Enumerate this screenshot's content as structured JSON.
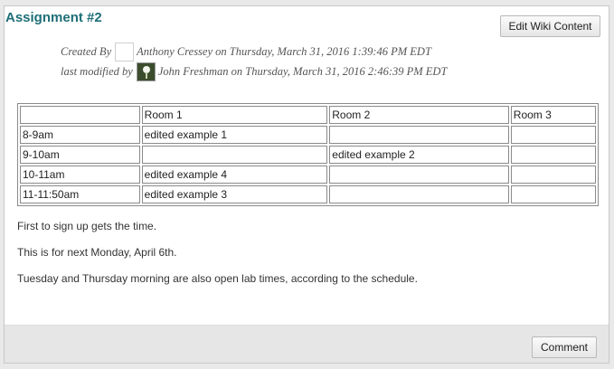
{
  "page": {
    "title": "Assignment #2",
    "edit_button_label": "Edit Wiki Content"
  },
  "meta": {
    "created_label": "Created By",
    "created_text": "Anthony Cressey on Thursday, March 31, 2016 1:39:46 PM EDT",
    "modified_label": "last modified by",
    "modified_text": "John Freshman on Thursday, March 31, 2016 2:46:39 PM EDT"
  },
  "table": {
    "rows": [
      [
        "",
        "Room 1",
        "Room 2",
        "Room 3"
      ],
      [
        "8-9am",
        " edited example 1",
        "",
        ""
      ],
      [
        "9-10am",
        "",
        "edited example 2",
        ""
      ],
      [
        "10-11am",
        " edited example 4",
        "",
        ""
      ],
      [
        "11-11:50am",
        "edited example 3",
        "",
        ""
      ]
    ]
  },
  "body": {
    "paragraphs": [
      "First to sign up gets the time.",
      "This is for next Monday, April 6th.",
      "Tuesday and Thursday morning are also open lab times, according to the schedule."
    ]
  },
  "footer": {
    "comment_button_label": "Comment"
  },
  "colors": {
    "title": "#1e6f78",
    "footer_bg": "#e6e6e6"
  }
}
